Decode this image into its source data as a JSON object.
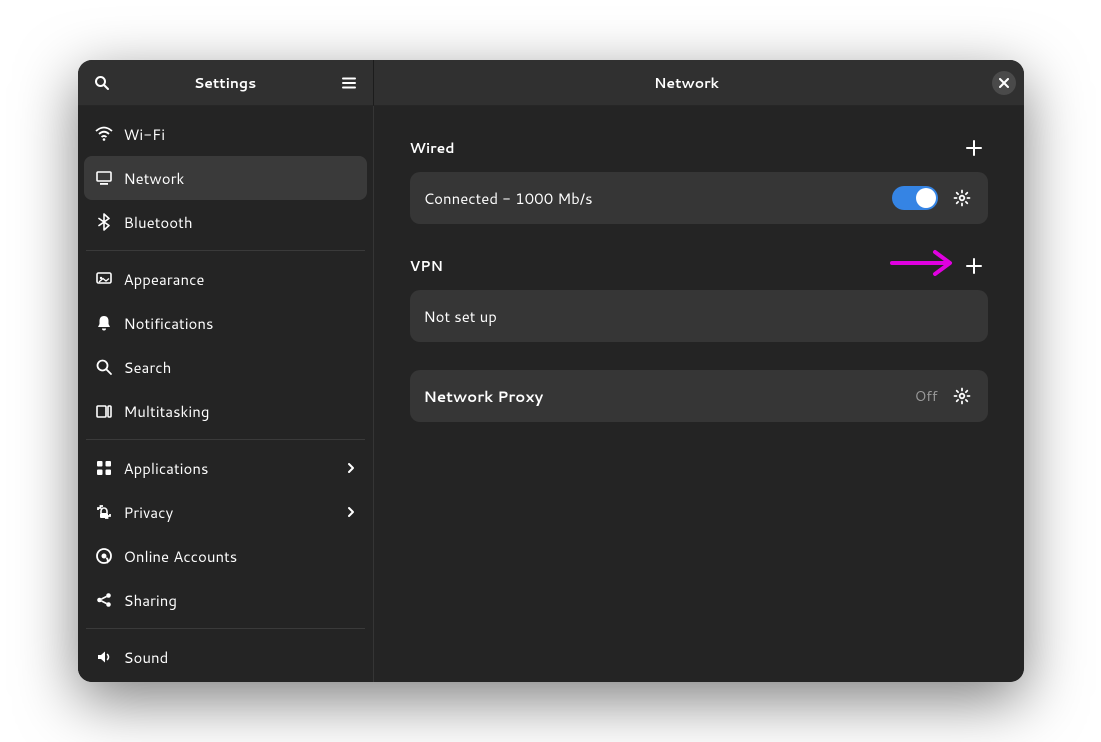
{
  "titlebar": {
    "sidebar_title": "Settings",
    "main_title": "Network"
  },
  "sidebar": {
    "items": [
      {
        "label": "Wi-Fi",
        "icon": "wifi"
      },
      {
        "label": "Network",
        "icon": "network",
        "selected": true
      },
      {
        "label": "Bluetooth",
        "icon": "bluetooth"
      }
    ],
    "items2": [
      {
        "label": "Appearance",
        "icon": "appearance"
      },
      {
        "label": "Notifications",
        "icon": "notifications"
      },
      {
        "label": "Search",
        "icon": "search"
      },
      {
        "label": "Multitasking",
        "icon": "multitasking"
      }
    ],
    "items3": [
      {
        "label": "Applications",
        "icon": "applications",
        "chevron": true
      },
      {
        "label": "Privacy",
        "icon": "privacy",
        "chevron": true
      },
      {
        "label": "Online Accounts",
        "icon": "online-accounts"
      },
      {
        "label": "Sharing",
        "icon": "sharing"
      }
    ],
    "items4": [
      {
        "label": "Sound",
        "icon": "sound"
      }
    ]
  },
  "main": {
    "wired": {
      "title": "Wired",
      "status": "Connected - 1000 Mb/s"
    },
    "vpn": {
      "title": "VPN",
      "status": "Not set up"
    },
    "proxy": {
      "title": "Network Proxy",
      "status": "Off"
    }
  },
  "annotation": {
    "arrow_color": "#e000e0"
  }
}
